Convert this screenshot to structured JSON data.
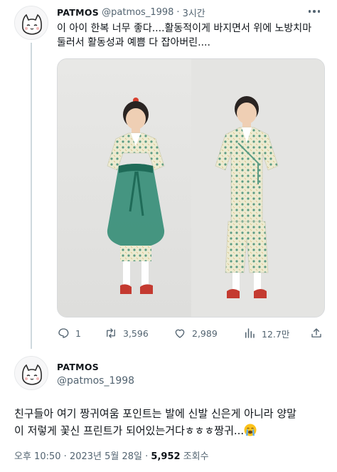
{
  "reply_tweet": {
    "display_name": "PATMOS",
    "handle": "@patmos_1998",
    "separator": "·",
    "time_ago": "3시간",
    "text_line1": "이 아이 한복 너무 좋다....활동적이게 바지면서 위에 노방치마",
    "text_line2": "둘러서 활동성과 예쁨 다 잡아버린....",
    "stats": {
      "replies": "1",
      "retweets": "3,596",
      "likes": "2,989",
      "views": "12.7만"
    },
    "icons": [
      "more-icon",
      "reply-icon",
      "retweet-icon",
      "like-icon",
      "views-icon",
      "share-icon"
    ]
  },
  "main_tweet": {
    "display_name": "PATMOS",
    "handle": "@patmos_1998",
    "text_line1": "친구들아 여기 짱귀여움 포인트는 발에 신발 신은게 아니라 양말",
    "text_line2": "이 저렇게 꽃신 프린트가 되어있는거다ㅎㅎㅎ짱귀...",
    "emoji": "loudly-crying-face",
    "time": "오후 10:50",
    "separator": "·",
    "date": "2023년 5월 28일",
    "views_count": "5,952",
    "views_label": "조회수"
  },
  "colors": {
    "text": "#0f1419",
    "muted": "#536471",
    "thread_line": "#cfd9de",
    "skirt_green": "#2f8a73",
    "fabric": "#e9e6c9"
  }
}
